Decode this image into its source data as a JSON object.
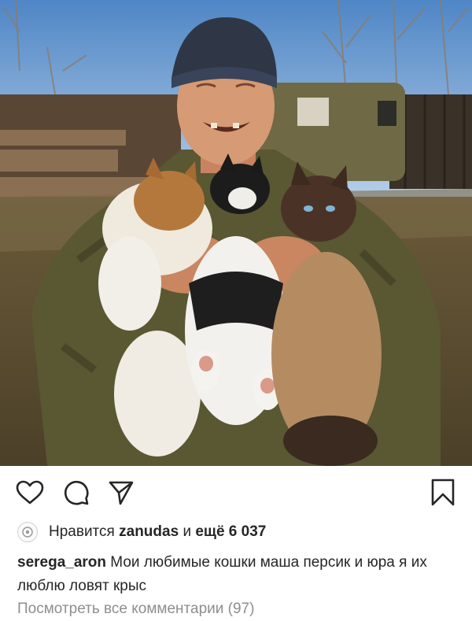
{
  "post": {
    "image_alt": "",
    "actions": {
      "like_icon": "heart-icon",
      "comment_icon": "comment-bubble-icon",
      "share_icon": "paper-plane-icon",
      "save_icon": "bookmark-icon"
    },
    "likes": {
      "prefix": "Нравится",
      "liked_by": "zanudas",
      "connector": "и",
      "others": "ещё 6 037"
    },
    "caption": {
      "username": "serega_aron",
      "text": "Мои любимые кошки маша персик и юра я их люблю ловят крыс"
    },
    "view_comments": "Посмотреть все комментарии (97)"
  },
  "colors": {
    "text": "#262626",
    "muted": "#8e8e8e",
    "background": "#ffffff"
  }
}
